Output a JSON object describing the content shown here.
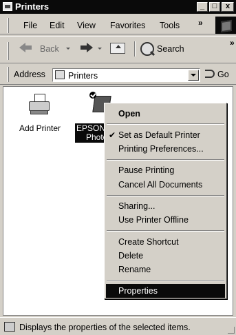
{
  "window": {
    "title": "Printers",
    "controls": {
      "minimize": "_",
      "maximize": "□",
      "close": "x"
    }
  },
  "menubar": {
    "items": [
      "File",
      "Edit",
      "View",
      "Favorites",
      "Tools"
    ],
    "overflow": "»"
  },
  "toolbar": {
    "back_label": "Back",
    "search_label": "Search",
    "overflow": "»"
  },
  "address": {
    "label": "Address",
    "value": "Printers",
    "go_label": "Go"
  },
  "content": {
    "items": [
      {
        "label": "Add Printer",
        "icon": "add-printer-icon"
      },
      {
        "label_line1": "EPSON",
        "label_line2": "Photo",
        "icon": "epson-printer-icon",
        "selected": true,
        "default": true
      }
    ]
  },
  "context_menu": {
    "groups": [
      [
        {
          "label": "Open",
          "bold": true
        }
      ],
      [
        {
          "label": "Set as Default Printer",
          "checked": true
        },
        {
          "label": "Printing Preferences..."
        }
      ],
      [
        {
          "label": "Pause Printing"
        },
        {
          "label": "Cancel All Documents"
        }
      ],
      [
        {
          "label": "Sharing..."
        },
        {
          "label": "Use Printer Offline"
        }
      ],
      [
        {
          "label": "Create Shortcut"
        },
        {
          "label": "Delete"
        },
        {
          "label": "Rename"
        }
      ],
      [
        {
          "label": "Properties",
          "highlighted": true
        }
      ]
    ],
    "check_glyph": "✔"
  },
  "statusbar": {
    "text": "Displays the properties of the selected items."
  },
  "colors": {
    "face": "#d4d0c8",
    "highlight": "#0a0a0a",
    "title_bar": "#0a0a0a"
  }
}
